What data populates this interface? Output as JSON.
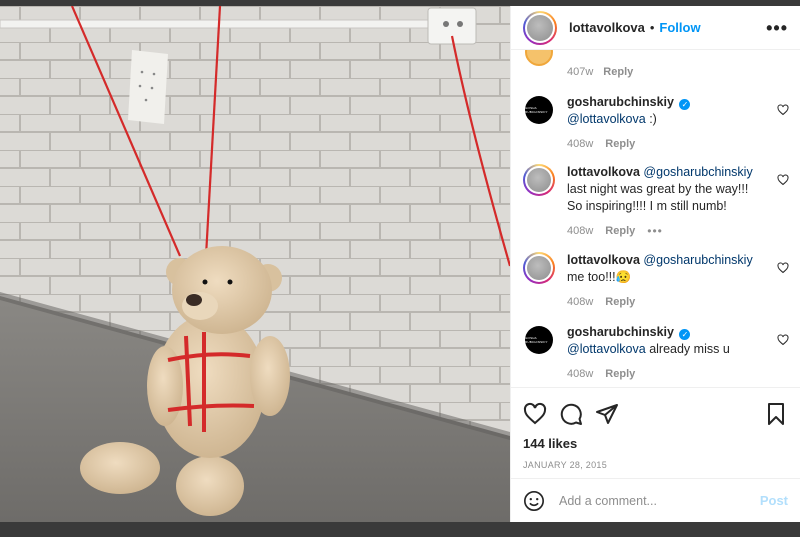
{
  "header": {
    "username": "lottavolkova",
    "separator": "•",
    "follow_label": "Follow",
    "more_label": "•••"
  },
  "partial_comment": {
    "time": "407w",
    "reply_label": "Reply"
  },
  "comments": [
    {
      "username": "gosharubchinskiy",
      "verified": true,
      "avatar": "dark-logo",
      "mention": "@lottavolkova",
      "text": ":)",
      "time": "408w",
      "reply_label": "Reply"
    },
    {
      "username": "lottavolkova",
      "verified": false,
      "avatar": "story-ring",
      "mention": "@gosharubchinskiy",
      "text": "last night was great by the way!!! So inspiring!!!! I m still numb!",
      "time": "408w",
      "reply_label": "Reply",
      "options_label": "•••"
    },
    {
      "username": "lottavolkova",
      "verified": false,
      "avatar": "story-ring",
      "mention": "@gosharubchinskiy",
      "text": "me too!!!😥",
      "time": "408w",
      "reply_label": "Reply"
    },
    {
      "username": "gosharubchinskiy",
      "verified": true,
      "avatar": "dark-logo",
      "mention": "@lottavolkova",
      "text": "already miss u",
      "time": "408w",
      "reply_label": "Reply"
    }
  ],
  "actions": {
    "like_icon": "heart-icon",
    "comment_icon": "comment-icon",
    "share_icon": "paper-plane-icon",
    "save_icon": "bookmark-icon"
  },
  "likes": "144 likes",
  "date": "JANUARY 28, 2015",
  "add_comment": {
    "emoji_icon": "smiley-icon",
    "placeholder": "Add a comment...",
    "post_label": "Post"
  },
  "colors": {
    "follow": "#0095f6",
    "post_disabled": "#b2dffc",
    "muted": "#8e8e8e",
    "rope": "#d42a2a"
  }
}
